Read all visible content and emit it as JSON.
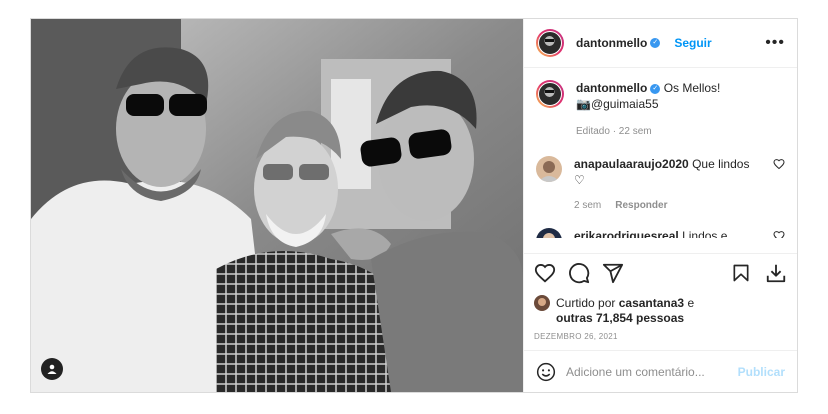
{
  "post": {
    "author": "dantonmello",
    "follow_label": "Seguir",
    "more_label": "•••",
    "caption_text": "Os Mellos!",
    "caption_mention": "📷@guimaia55",
    "caption_edited": "Editado · 22 sem"
  },
  "comments": [
    {
      "user": "anapaulaaraujo2020",
      "text": "Que lindos",
      "heart": "♡",
      "time": "2 sem",
      "reply_label": "Responder"
    },
    {
      "user": "erikarodriguesreal",
      "text": "Lindos e"
    }
  ],
  "likes": {
    "prefix": "Curtido por",
    "user": "casantana3",
    "conj": "e",
    "others": "outras 71,854 pessoas"
  },
  "date": "DEZEMBRO 26, 2021",
  "comment_box": {
    "placeholder": "Adicione um comentário...",
    "publish_label": "Publicar"
  },
  "icons": {
    "like": "heart-icon",
    "comment": "comment-icon",
    "share": "share-icon",
    "save": "bookmark-icon",
    "download": "download-icon",
    "emoji": "emoji-icon",
    "user_tag": "user-tag-icon"
  },
  "colors": {
    "link": "#0095f6",
    "verified": "#3897f0",
    "muted": "#8e8e8e",
    "publish_disabled": "#b2dffc"
  }
}
